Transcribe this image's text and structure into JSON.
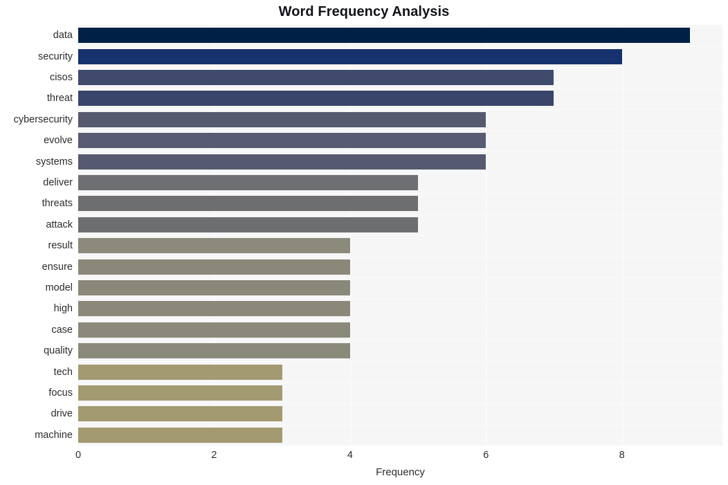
{
  "chart_data": {
    "type": "bar",
    "orientation": "horizontal",
    "title": "Word Frequency Analysis",
    "xlabel": "Frequency",
    "ylabel": "",
    "categories": [
      "data",
      "security",
      "cisos",
      "threat",
      "cybersecurity",
      "evolve",
      "systems",
      "deliver",
      "threats",
      "attack",
      "result",
      "ensure",
      "model",
      "high",
      "case",
      "quality",
      "tech",
      "focus",
      "drive",
      "machine"
    ],
    "values": [
      9,
      8,
      7,
      7,
      6,
      6,
      6,
      5,
      5,
      5,
      4,
      4,
      4,
      4,
      4,
      4,
      3,
      3,
      3,
      3
    ],
    "bar_colors": [
      "#012046",
      "#16316d",
      "#3f4a6d",
      "#39456b",
      "#565a6f",
      "#585c72",
      "#555a70",
      "#6e6f72",
      "#6d6e70",
      "#6d6e70",
      "#8c8a7b",
      "#8a8879",
      "#8a8879",
      "#8a8879",
      "#8b897a",
      "#8b8979",
      "#a39a71",
      "#a39a71",
      "#a39a71",
      "#a39a71"
    ],
    "xlim": [
      0,
      9.48
    ],
    "xticks": [
      0,
      2,
      4,
      6,
      8
    ],
    "xticklabels": [
      "0",
      "2",
      "4",
      "6",
      "8"
    ],
    "grid": true,
    "grid_axis": "x",
    "legend": "none",
    "plot_background": "#f6f6f7",
    "figure_background": "#ffffff",
    "colormap": "cividis"
  }
}
